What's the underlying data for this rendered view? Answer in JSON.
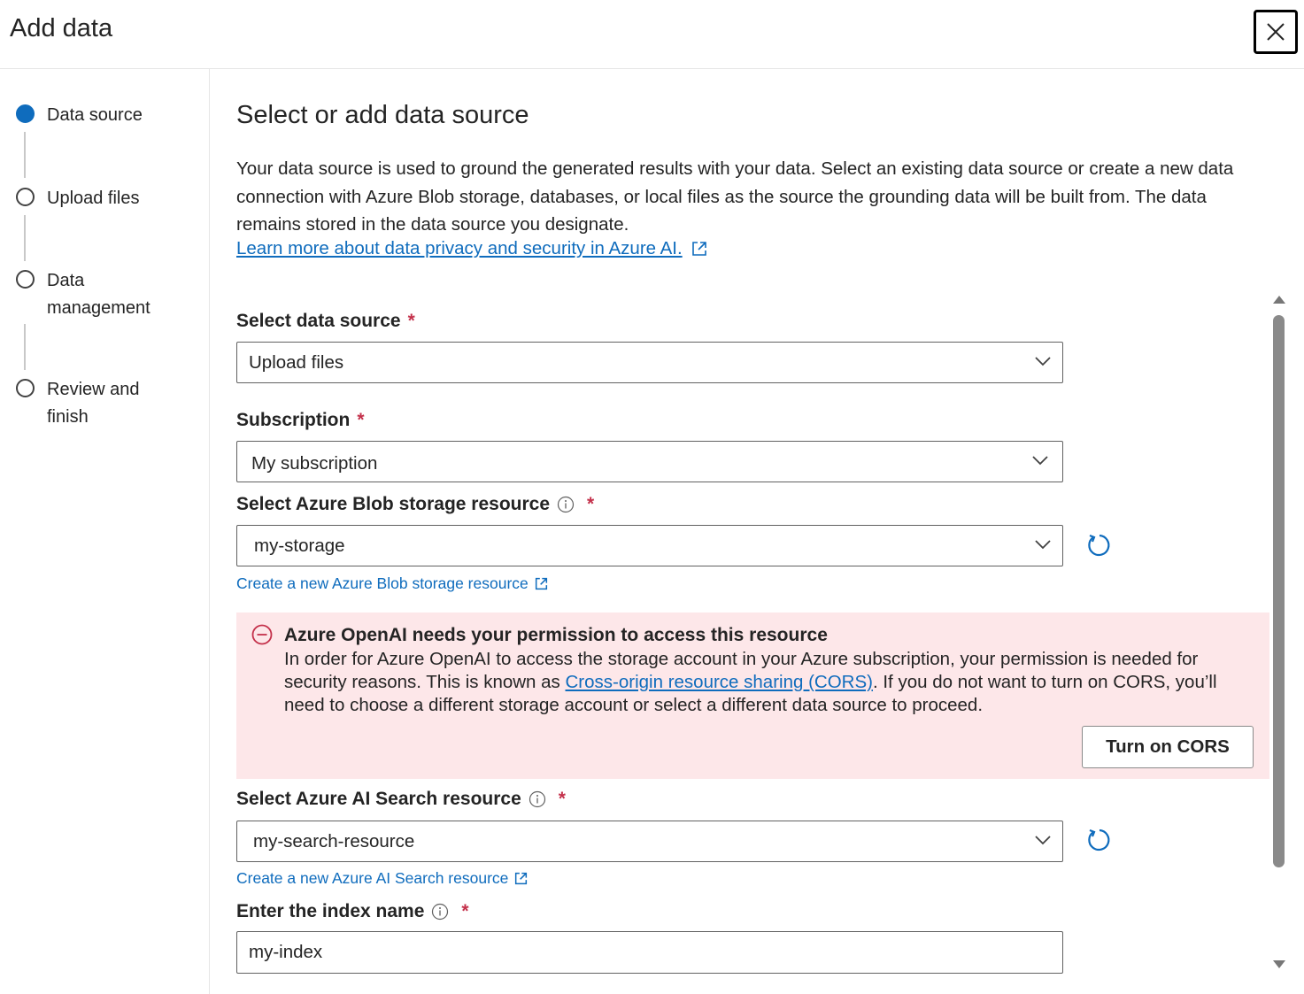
{
  "header": {
    "title": "Add data"
  },
  "steps": [
    {
      "label": "Data source",
      "active": true
    },
    {
      "label": "Upload files",
      "active": false
    },
    {
      "label": "Data management",
      "active": false
    },
    {
      "label": "Review and finish",
      "active": false
    }
  ],
  "main": {
    "title": "Select or add data source",
    "description": "Your data source is used to ground the generated results with your data. Select an existing data source or create a new data connection with Azure Blob storage, databases, or local files as the source the grounding data will be built from. The data remains stored in the data source you designate.",
    "learn_link": "Learn more about data privacy and security in Azure AI."
  },
  "fields": {
    "data_source": {
      "label": "Select data source",
      "required": "*",
      "value": "Upload files"
    },
    "subscription": {
      "label": "Subscription",
      "required": "*",
      "value": "My subscription"
    },
    "blob": {
      "label": "Select Azure Blob storage resource",
      "required": "*",
      "value": "my-storage",
      "create_link": "Create a new Azure Blob storage resource"
    },
    "search": {
      "label": "Select Azure AI Search resource",
      "required": "*",
      "value": "my-search-resource",
      "create_link": "Create a new Azure AI Search resource"
    },
    "index": {
      "label": "Enter the index name",
      "required": "*",
      "value": "my-index"
    }
  },
  "alert": {
    "title": "Azure OpenAI needs your permission to access this resource",
    "body_1": "In order for Azure OpenAI to access the storage account in your Azure subscription, your permission is needed for security reasons. This is known as ",
    "link": "Cross-origin resource sharing (CORS)",
    "body_2": ". If you do not want to turn on CORS, you’ll need to choose a different storage account or select a different data source to proceed.",
    "button": "Turn on CORS"
  },
  "colors": {
    "accent": "#0f6cbd",
    "error_bg": "#fde7e9",
    "error_icon": "#c4314b",
    "required": "#c4314b"
  },
  "icons": [
    "close-icon",
    "external-link-icon",
    "chevron-down-icon",
    "info-icon",
    "refresh-icon",
    "error-circle-icon"
  ]
}
